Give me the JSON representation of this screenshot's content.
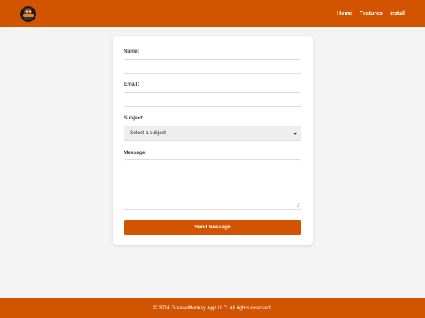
{
  "header": {
    "logo_icon": "monkey-logo-icon",
    "nav": [
      {
        "label": "Home"
      },
      {
        "label": "Features"
      },
      {
        "label": "Install"
      }
    ]
  },
  "form": {
    "name_label": "Name:",
    "name_value": "",
    "email_label": "Email:",
    "email_value": "",
    "subject_label": "Subject:",
    "subject_selected": "Select a subject",
    "message_label": "Message:",
    "message_value": "",
    "submit_label": "Send Message"
  },
  "footer": {
    "text": "© 2024 GreaseMonkey App LLC. All rights reserved."
  },
  "colors": {
    "brand": "#d35400",
    "page_background": "#f4f4f4",
    "card_background": "#ffffff"
  }
}
